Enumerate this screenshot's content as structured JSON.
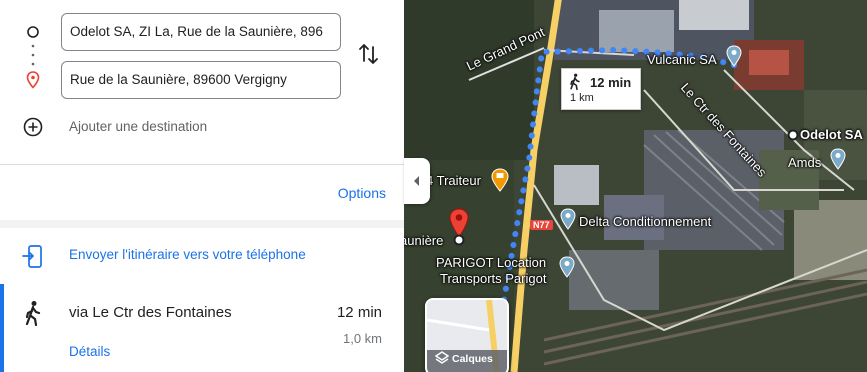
{
  "directions": {
    "origin_value": "Odelot SA, ZI La, Rue de la Saunière, 896",
    "destination_value": "Rue de la Saunière, 89600 Vergigny",
    "add_destination": "Ajouter une destination",
    "options": "Options",
    "send_to_phone": "Envoyer l'itinéraire vers votre téléphone"
  },
  "route": {
    "via": "via Le Ctr des Fontaines",
    "duration": "12 min",
    "distance": "1,0 km",
    "details": "Détails"
  },
  "map": {
    "info_duration": "12 min",
    "info_distance": "1 km",
    "labels": {
      "grand_pont": "Le Grand Pont",
      "vulcanic": "Vulcanic SA",
      "ctr_fontaines": "Le Ctr des Fontaines",
      "odelot": "Odelot SA",
      "amds": "Amds",
      "traiteur": "4 Traiteur",
      "delta": "Delta Conditionnement",
      "sauniere": "aunière",
      "parigot1": "PARIGOT Location",
      "parigot2": "Transports Parigot",
      "road_n77": "N77",
      "layers": "Calques"
    },
    "colors": {
      "route": "#4285f4",
      "pin": "#ea4335",
      "poi": "#7baac9",
      "road": "#f6cf65"
    }
  }
}
